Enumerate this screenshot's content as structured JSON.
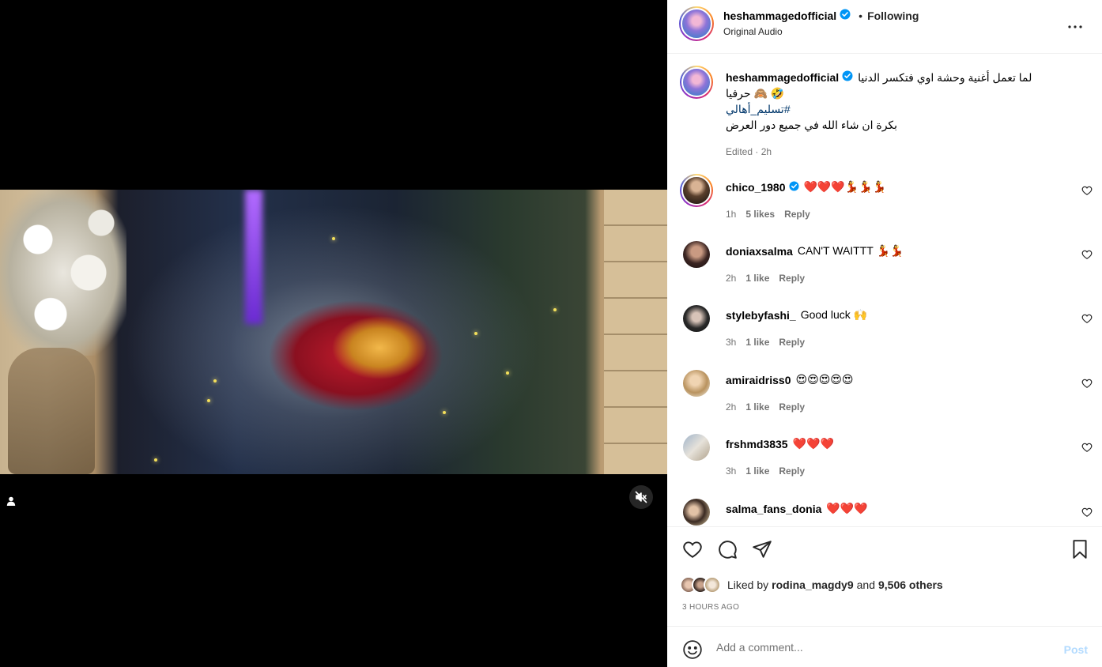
{
  "post": {
    "username": "heshammagedofficial",
    "follow_status": "Following",
    "separator": "•",
    "audio": "Original Audio"
  },
  "caption": {
    "username": "heshammagedofficial",
    "line1": "لما تعمل أغنية وحشة اوي فتكسر الدنيا",
    "line2": "🤣 🙈 حرفيا",
    "hashtag": "#تسليم_أهالي",
    "line4": "بكرة ان شاء الله في جميع دور العرض",
    "meta": "Edited · 2h"
  },
  "comments": [
    {
      "username": "chico_1980",
      "verified": true,
      "text": "❤️❤️❤️💃💃💃",
      "time": "1h",
      "likes": "5 likes",
      "reply": "Reply"
    },
    {
      "username": "doniaxsalma",
      "verified": false,
      "text": "CAN'T WAITTT 💃💃",
      "time": "2h",
      "likes": "1 like",
      "reply": "Reply"
    },
    {
      "username": "stylebyfashi_",
      "verified": false,
      "text": "Good luck 🙌",
      "time": "3h",
      "likes": "1 like",
      "reply": "Reply"
    },
    {
      "username": "amiraidriss0",
      "verified": false,
      "text": "😍😍😍😍😍",
      "time": "2h",
      "likes": "1 like",
      "reply": "Reply"
    },
    {
      "username": "frshmd3835",
      "verified": false,
      "text": "❤️❤️❤️",
      "time": "3h",
      "likes": "1 like",
      "reply": "Reply"
    },
    {
      "username": "salma_fans_donia",
      "verified": false,
      "text": "❤️❤️❤️",
      "time": "",
      "likes": "",
      "reply": ""
    }
  ],
  "likes": {
    "prefix": "Liked by",
    "user": "rodina_magdy9",
    "conj": "and",
    "others": "9,506 others"
  },
  "timestamp": "3 HOURS AGO",
  "add_comment": {
    "placeholder": "Add a comment...",
    "post_label": "Post"
  },
  "icons": {
    "verified": "verified-badge-icon",
    "more": "more-options-icon",
    "like": "heart-icon",
    "comment": "comment-icon",
    "share": "share-icon",
    "save": "bookmark-icon",
    "emoji": "emoji-icon",
    "mute": "muted-speaker-icon",
    "profile": "user-icon"
  },
  "colors": {
    "verified": "#0095f6",
    "post_disabled": "#b3dbff",
    "hashtag": "#00376b"
  }
}
